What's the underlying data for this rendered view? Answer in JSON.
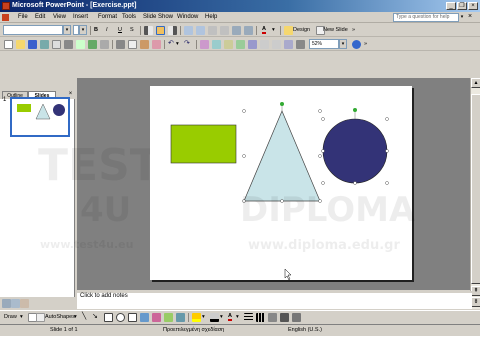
{
  "window": {
    "title": "Microsoft PowerPoint - [Exercise.ppt]",
    "minimize": "_",
    "restore": "❐",
    "close": "×"
  },
  "menu": {
    "items": [
      "File",
      "Edit",
      "View",
      "Insert",
      "Format",
      "Tools",
      "Slide Show",
      "Window",
      "Help"
    ],
    "help_placeholder": "Type a question for help",
    "help_arrow": "▾"
  },
  "formatting": {
    "font_name": "",
    "font_size": "",
    "bold": "B",
    "italic": "I",
    "underline": "U",
    "shadow": "S",
    "font_color_label": "A",
    "design_label": "Design",
    "new_slide_label": "New Slide"
  },
  "standard": {
    "zoom": "52%"
  },
  "left_pane": {
    "tab_outline": "Outline",
    "tab_slides": "Slides",
    "close": "×",
    "slide_number": "1"
  },
  "notes": {
    "placeholder": "Click to add notes"
  },
  "drawing": {
    "draw_label": "Draw",
    "autoshapes_label": "AutoShapes"
  },
  "status": {
    "slide_info": "Slide 1 of 1",
    "design_name": "Προεπιλεγμένη σχεδίαση",
    "language": "English (U.S.)"
  },
  "watermark": {
    "test": "TEST",
    "four_u": "4U",
    "diploma": "DIPLOMA",
    "url_left": "www.test4u.eu",
    "url_right": "www.diploma.edu.gr"
  },
  "shapes": {
    "rectangle_color": "#99cc00",
    "triangle_color": "#c9e4e8",
    "circle_color": "#333377",
    "rotate_handle_color": "#33aa33"
  },
  "colors": {
    "titlebar": "#0a246a",
    "selection": "#316ac5"
  }
}
